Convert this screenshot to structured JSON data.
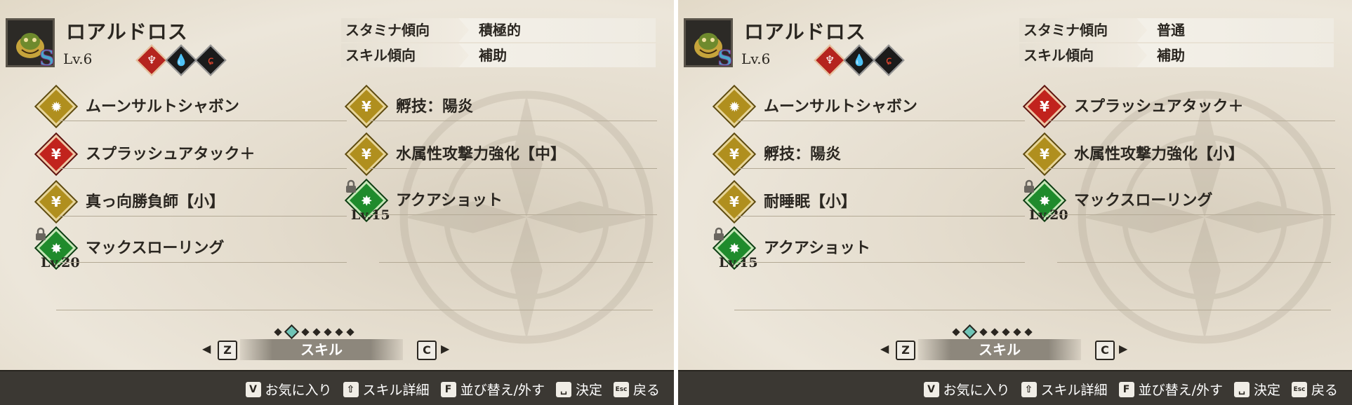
{
  "left": {
    "monster_name": "ロアルドロス",
    "rank": "S",
    "level": "Lv.6",
    "info": [
      {
        "key": "スタミナ傾向",
        "value": "積極的"
      },
      {
        "key": "スキル傾向",
        "value": "補助"
      }
    ],
    "skills_col1": [
      {
        "name": "ムーンサルトシャボン",
        "icon": "sun-burst-icon",
        "color": "gold",
        "locked": false,
        "req": ""
      },
      {
        "name": "スプラッシュアタック＋",
        "icon": "power-figure-icon",
        "color": "red",
        "locked": false,
        "req": ""
      },
      {
        "name": "真っ向勝負師【小】",
        "icon": "buff-figure-icon",
        "color": "gold",
        "locked": false,
        "req": ""
      },
      {
        "name": "マックスローリング",
        "icon": "splash-burst-icon",
        "color": "green",
        "locked": true,
        "req": "Lv.20"
      }
    ],
    "skills_col2": [
      {
        "name": "孵技：陽炎",
        "icon": "buff-figure-icon",
        "color": "gold",
        "locked": false,
        "req": ""
      },
      {
        "name": "水属性攻撃力強化【中】",
        "icon": "buff-figure-icon",
        "color": "gold",
        "locked": false,
        "req": ""
      },
      {
        "name": "アクアショット",
        "icon": "splash-burst-icon",
        "color": "green",
        "locked": true,
        "req": "Lv.15"
      }
    ]
  },
  "right": {
    "monster_name": "ロアルドロス",
    "rank": "S",
    "level": "Lv.6",
    "info": [
      {
        "key": "スタミナ傾向",
        "value": "普通"
      },
      {
        "key": "スキル傾向",
        "value": "補助"
      }
    ],
    "skills_col1": [
      {
        "name": "ムーンサルトシャボン",
        "icon": "sun-burst-icon",
        "color": "gold",
        "locked": false,
        "req": ""
      },
      {
        "name": "孵技：陽炎",
        "icon": "buff-figure-icon",
        "color": "gold",
        "locked": false,
        "req": ""
      },
      {
        "name": "耐睡眠【小】",
        "icon": "buff-figure-icon",
        "color": "gold",
        "locked": false,
        "req": ""
      },
      {
        "name": "アクアショット",
        "icon": "splash-burst-icon",
        "color": "green",
        "locked": true,
        "req": "Lv.15"
      }
    ],
    "skills_col2": [
      {
        "name": "スプラッシュアタック＋",
        "icon": "power-figure-icon",
        "color": "red",
        "locked": false,
        "req": ""
      },
      {
        "name": "水属性攻撃力強化【小】",
        "icon": "buff-figure-icon",
        "color": "gold",
        "locked": false,
        "req": ""
      },
      {
        "name": "マックスローリング",
        "icon": "splash-burst-icon",
        "color": "green",
        "locked": true,
        "req": "Lv.20"
      }
    ]
  },
  "tabs": {
    "left_key": "Z",
    "right_key": "C",
    "label": "スキル",
    "page_count": 7,
    "active_page": 2
  },
  "footer": [
    {
      "key": "V",
      "label": "お気に入り"
    },
    {
      "key": "⇧",
      "label": "スキル詳細"
    },
    {
      "key": "F",
      "label": "並び替え/外す"
    },
    {
      "key": "␣",
      "label": "決定"
    },
    {
      "key": "Esc",
      "label": "戻る"
    }
  ],
  "colors": {
    "gold": "#b08f1e",
    "red": "#c1231d",
    "green": "#1f8b2c",
    "text": "#2a2620",
    "footer_bg": "#3b3833"
  }
}
